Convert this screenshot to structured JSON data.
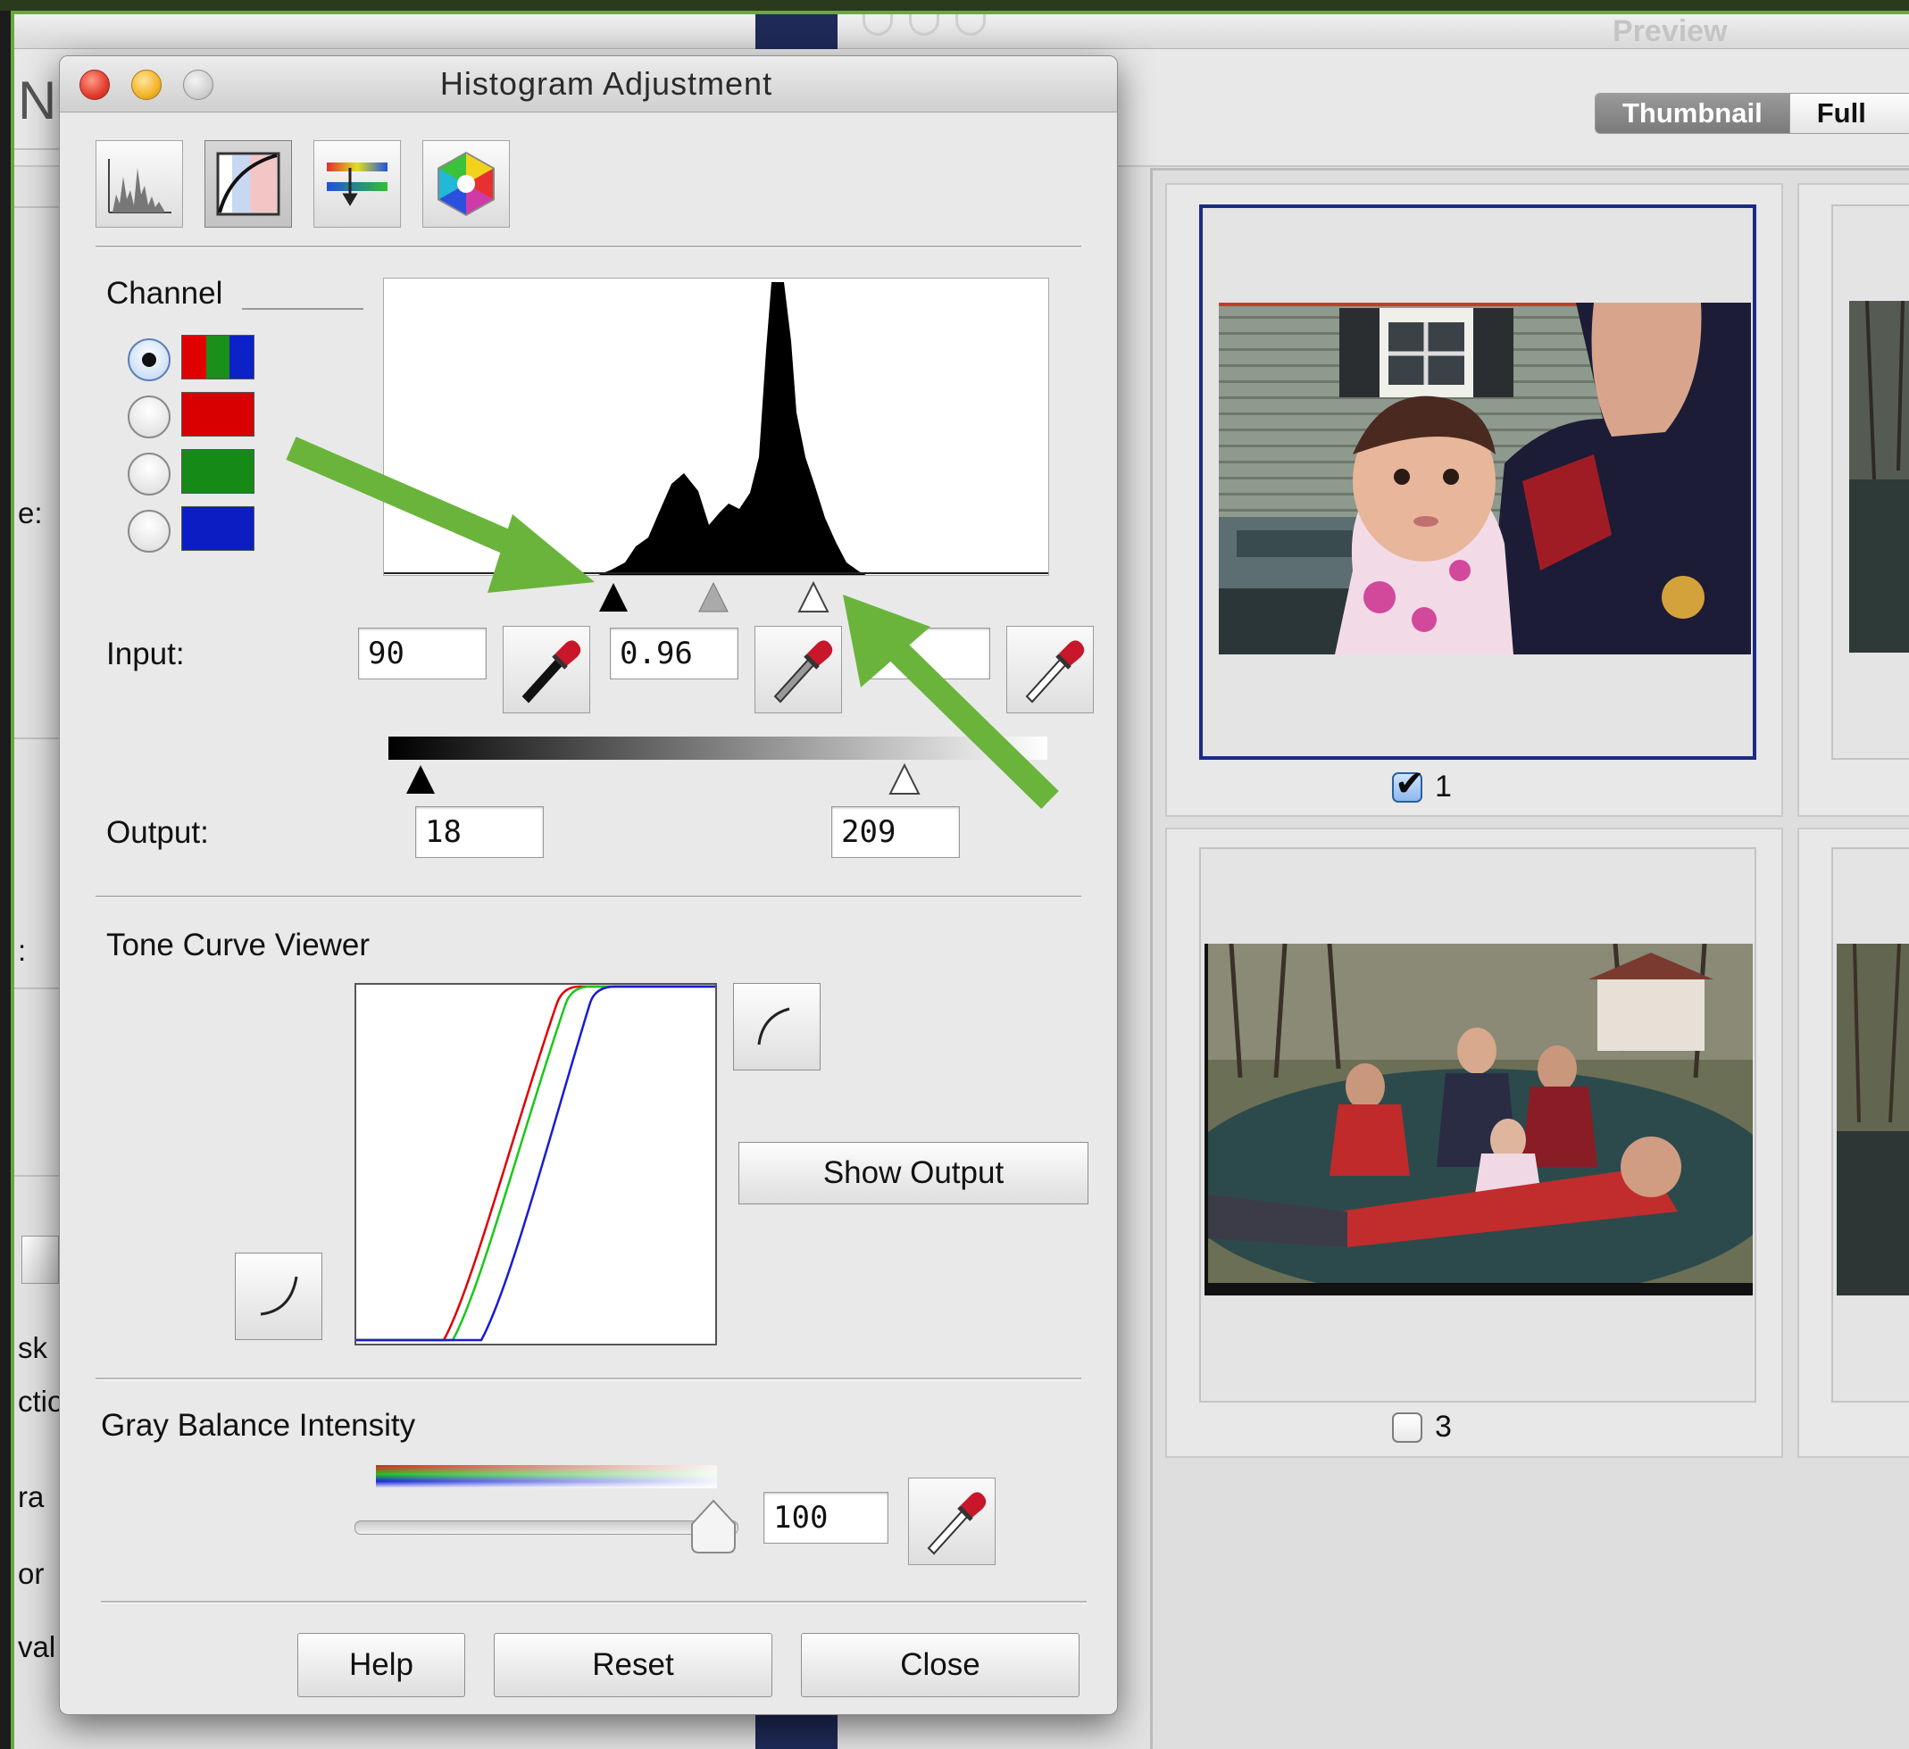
{
  "preview_window": {
    "title": "Preview",
    "tabs": [
      "Thumbnail",
      "Full S"
    ],
    "active_tab": "Thumbnail",
    "thumbnails": [
      {
        "number": "1",
        "checked": true,
        "selected": true
      },
      {
        "number": "3",
        "checked": false,
        "selected": false
      }
    ],
    "edge_labels": [
      "N",
      "e:",
      ":",
      "sk",
      "ctio",
      "ra",
      "or",
      "val"
    ]
  },
  "dialog": {
    "title": "Histogram Adjustment",
    "tools": [
      {
        "name": "histogram-tool-icon"
      },
      {
        "name": "tone-curve-tool-icon"
      },
      {
        "name": "color-balance-tool-icon"
      },
      {
        "name": "color-wheel-tool-icon"
      }
    ],
    "channel": {
      "label": "Channel",
      "options": [
        {
          "name": "rgb",
          "colors": [
            "#e00000",
            "#1a8f1a",
            "#0a22c8"
          ],
          "selected": true
        },
        {
          "name": "red",
          "colors": [
            "#d80000"
          ],
          "selected": false
        },
        {
          "name": "green",
          "colors": [
            "#168a16"
          ],
          "selected": false
        },
        {
          "name": "blue",
          "colors": [
            "#0a1ec4"
          ],
          "selected": false
        }
      ]
    },
    "input": {
      "label": "Input:",
      "black_point": "90",
      "gamma": "0.96",
      "white_point": "19"
    },
    "output": {
      "label": "Output:",
      "min": "18",
      "max": "209"
    },
    "tone_curve": {
      "label": "Tone Curve Viewer",
      "show_output_label": "Show Output",
      "curve_colors": [
        "#e00000",
        "#19c819",
        "#1a1ad8"
      ]
    },
    "gray_balance": {
      "label": "Gray Balance Intensity",
      "value": "100",
      "slider_fraction": 1.0
    },
    "buttons": {
      "help": "Help",
      "reset": "Reset",
      "close": "Close"
    }
  },
  "annotations": {
    "arrow_color": "#6ab43c"
  }
}
